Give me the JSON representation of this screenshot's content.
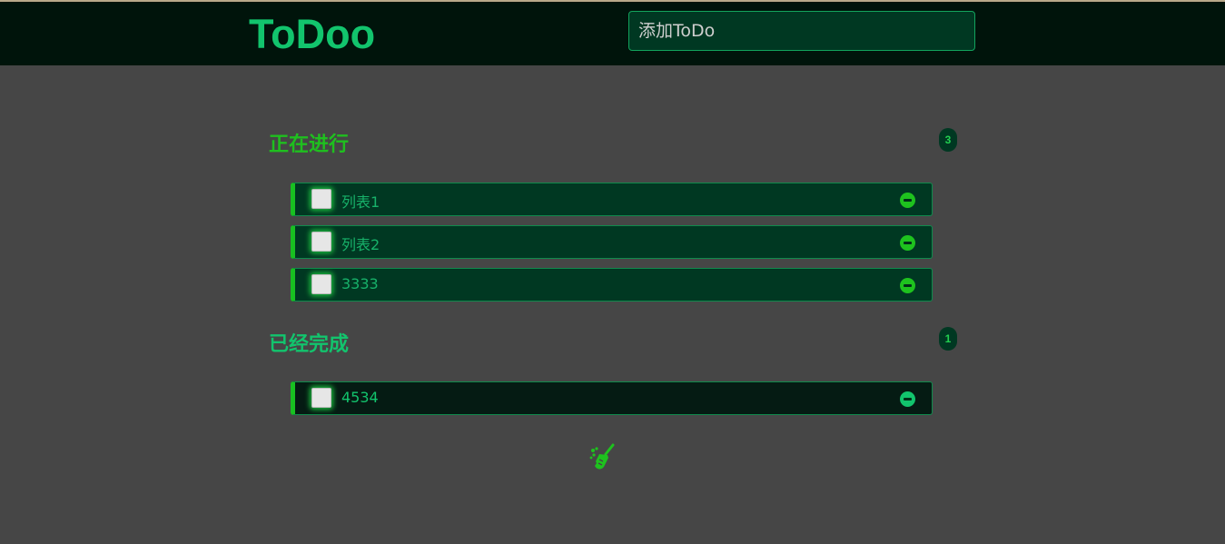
{
  "header": {
    "logo": "ToDoo",
    "add_placeholder": "添加ToDo"
  },
  "doing": {
    "title": "正在进行",
    "count": "3",
    "items": [
      {
        "text": "列表1"
      },
      {
        "text": "列表2"
      },
      {
        "text": "3333"
      }
    ]
  },
  "done": {
    "title": "已经完成",
    "count": "1",
    "items": [
      {
        "text": "4534"
      }
    ]
  },
  "footer": {
    "clear_icon": "broom-icon"
  },
  "colors": {
    "background": "#464646",
    "header": "#00140b",
    "accent": "#12c46d",
    "doing_title": "#1fbf1f",
    "item_bg": "#003822",
    "done_item_bg": "#051b13"
  }
}
